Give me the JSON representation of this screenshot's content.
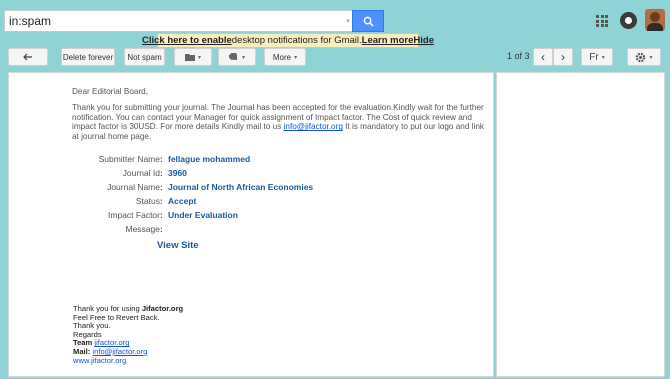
{
  "search": {
    "value": "in:spam"
  },
  "notification": {
    "link_text": "Click here to enable",
    "text": "desktop notifications for Gmail.",
    "learn_more": "Learn more",
    "hide": "Hide"
  },
  "toolbar": {
    "back_label": "←",
    "delete_forever": "Delete forever",
    "not_spam": "Not spam",
    "more": "More",
    "paging": "1 of 3",
    "prev": "‹",
    "next": "›",
    "input_tools": "Fr",
    "caret": "▾"
  },
  "email": {
    "greeting": "Dear Editorial Board,",
    "body_before": "Thank you for submitting your journal. The Journal has been accepted for the evaluation.Kindly wait for the further notification. You can contact your Manager for quick assignment of Impact factor. The Cost of quick review and impact factor is 30USD. For more details Kindly mail to us ",
    "body_link": "info@jifactor.org",
    "body_after": " It is mandatory to put our logo and link at journal home page.",
    "fields": [
      {
        "label": "Submitter Name",
        "value": "fellague mohammed"
      },
      {
        "label": "Journal Id",
        "value": "3960"
      },
      {
        "label": "Journal Name",
        "value": "Journal of North African Economies"
      },
      {
        "label": "Status",
        "value": "Accept"
      },
      {
        "label": "Impact Factor",
        "value": "Under Evaluation"
      },
      {
        "label": "Message",
        "value": ""
      }
    ],
    "colon": ":",
    "view_site": "View Site",
    "footer": {
      "thanks_prefix": "Thank you for using ",
      "thanks_brand": "Jifactor.org",
      "line2": "Feel Free to Revert Back.",
      "line3": "Thank you.",
      "line4": "Regards",
      "team_label": "Team ",
      "team_link": "jifactor.org",
      "mail_label": "Mail: ",
      "mail_link": "info@jifactor.org",
      "site": "www.jifactor.org"
    }
  },
  "colors": {
    "background": "#8fd3d6",
    "search_button": "#4d90fe",
    "notify_bg": "#f9edbe",
    "field_value": "#1a5a9a",
    "link": "#1155cc"
  },
  "icons": [
    "search-icon",
    "back-arrow-icon",
    "folder-icon",
    "label-icon",
    "apps-grid-icon",
    "notifications-icon",
    "settings-gear-icon"
  ]
}
